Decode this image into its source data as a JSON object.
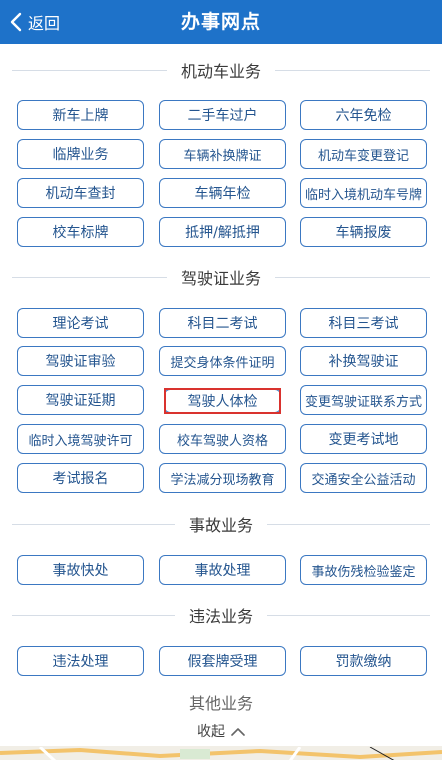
{
  "header": {
    "back_label": "返回",
    "title": "办事网点"
  },
  "sections": {
    "vehicle": {
      "title": "机动车业务",
      "items": [
        "新车上牌",
        "二手车过户",
        "六年免检",
        "临牌业务",
        "车辆补换牌证",
        "机动车变更登记",
        "机动车查封",
        "车辆年检",
        "临时入境机动车号牌",
        "校车标牌",
        "抵押/解抵押",
        "车辆报废"
      ]
    },
    "license": {
      "title": "驾驶证业务",
      "items": [
        "理论考试",
        "科目二考试",
        "科目三考试",
        "驾驶证审验",
        "提交身体条件证明",
        "补换驾驶证",
        "驾驶证延期",
        "驾驶人体检",
        "变更驾驶证联系方式",
        "临时入境驾驶许可",
        "校车驾驶人资格",
        "变更考试地",
        "考试报名",
        "学法减分现场教育",
        "交通安全公益活动"
      ],
      "highlighted": "驾驶人体检"
    },
    "accident": {
      "title": "事故业务",
      "items": [
        "事故快处",
        "事故处理",
        "事故伤残检验鉴定"
      ]
    },
    "violation": {
      "title": "违法业务",
      "items": [
        "违法处理",
        "假套牌受理",
        "罚款缴纳"
      ]
    },
    "other": {
      "title": "其他业务"
    }
  },
  "footer": {
    "collapse_label": "收起"
  },
  "colors": {
    "header_bg": "#1e72c9",
    "button_border": "#3b78c2",
    "highlight_border": "#d9322e"
  },
  "icons": {
    "back": "chevron-left-icon",
    "collapse": "chevron-up-icon"
  }
}
